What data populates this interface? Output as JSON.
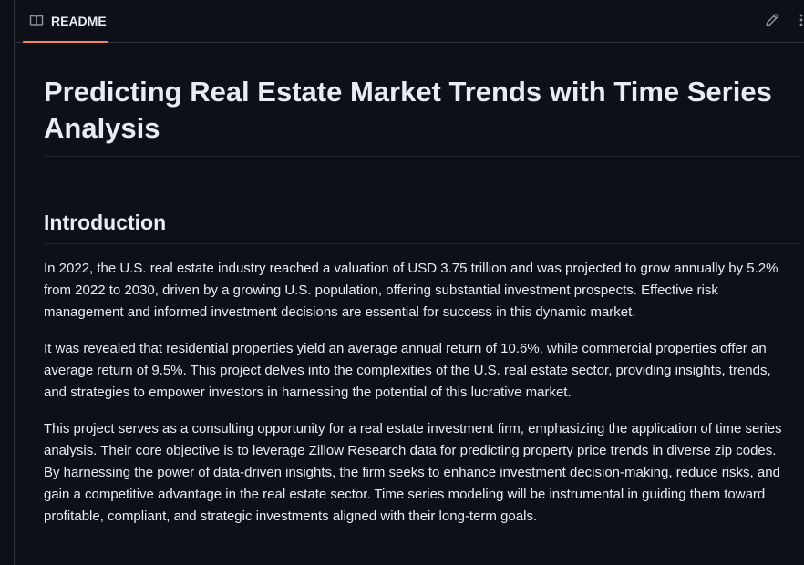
{
  "tab": {
    "label": "README",
    "icon": "book-icon",
    "accent_color": "#f78166"
  },
  "toolbar": {
    "edit_icon": "pencil-icon",
    "more_icon": "kebab-horizontal-icon"
  },
  "readme": {
    "title": "Predicting Real Estate Market Trends with Time Series Analysis",
    "section_heading": "Introduction",
    "paragraphs": [
      "In 2022, the U.S. real estate industry reached a valuation of USD 3.75 trillion and was projected to grow annually by 5.2% from 2022 to 2030, driven by a growing U.S. population, offering substantial investment prospects. Effective risk management and informed investment decisions are essential for success in this dynamic market.",
      "It was revealed that residential properties yield an average annual return of 10.6%, while commercial properties offer an average return of 9.5%. This project delves into the complexities of the U.S. real estate sector, providing insights, trends, and strategies to empower investors in harnessing the potential of this lucrative market.",
      "This project serves as a consulting opportunity for a real estate investment firm, emphasizing the application of time series analysis. Their core objective is to leverage Zillow Research data for predicting property price trends in diverse zip codes. By harnessing the power of data-driven insights, the firm seeks to enhance investment decision-making, reduce risks, and gain a competitive advantage in the real estate sector. Time series modeling will be instrumental in guiding them toward profitable, compliant, and strategic investments aligned with their long-term goals."
    ]
  }
}
